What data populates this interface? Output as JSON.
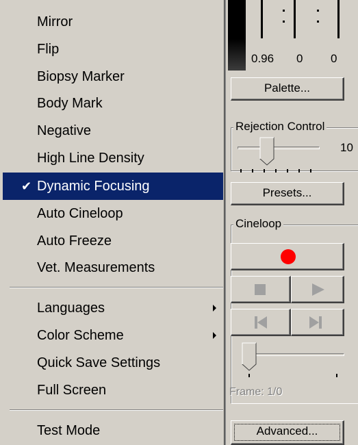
{
  "menu": {
    "items": [
      {
        "label": "Mirror"
      },
      {
        "label": "Flip"
      },
      {
        "label": "Biopsy Marker"
      },
      {
        "label": "Body Mark"
      },
      {
        "label": "Negative"
      },
      {
        "label": "High Line Density"
      },
      {
        "label": "Dynamic Focusing",
        "checked": true,
        "selected": true
      },
      {
        "label": "Auto Cineloop"
      },
      {
        "label": "Auto Freeze"
      },
      {
        "label": "Vet. Measurements"
      },
      {
        "label": "Languages",
        "submenu": true
      },
      {
        "label": "Color Scheme",
        "submenu": true
      },
      {
        "label": "Quick Save Settings"
      },
      {
        "label": "Full Screen"
      },
      {
        "label": "Test Mode"
      }
    ],
    "check_glyph": "✔",
    "highlight_color": "#0a246a"
  },
  "panel": {
    "readouts": {
      "v1": "0.96",
      "v2": "0",
      "v3": "0"
    },
    "palette_button": "Palette...",
    "rejection": {
      "title": "Rejection Control",
      "value": "10"
    },
    "presets_button": "Presets...",
    "cineloop": {
      "title": "Cineloop",
      "record_color": "#ff0000",
      "frame_label": "Frame: 1/0"
    },
    "advanced_button": "Advanced..."
  }
}
